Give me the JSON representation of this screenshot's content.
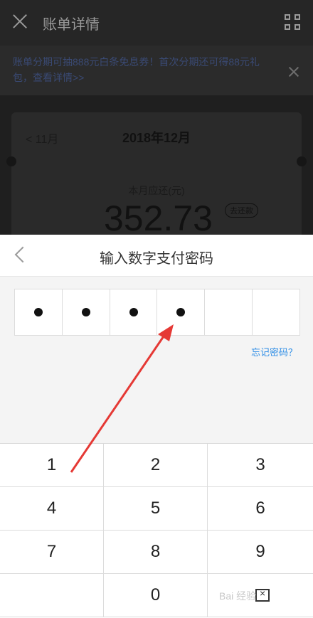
{
  "header": {
    "title": "账单详情"
  },
  "banner": {
    "text": "账单分期可抽888元白条免息券！首次分期还可得88元礼包，查看详情>>"
  },
  "bill": {
    "prev_month": "< 11月",
    "current_month": "2018年12月",
    "label": "本月应还(元)",
    "amount": "352.73",
    "pill": "去还款"
  },
  "payment_sheet": {
    "title": "输入数字支付密码",
    "pin_filled": 4,
    "pin_length": 6,
    "forgot_link": "忘记密码？"
  },
  "keypad": {
    "keys": [
      "1",
      "2",
      "3",
      "4",
      "5",
      "6",
      "7",
      "8",
      "9",
      "",
      "0",
      ""
    ]
  },
  "watermark": "Bai 经验",
  "colors": {
    "link": "#2f8ee6",
    "arrow": "#e53935"
  }
}
